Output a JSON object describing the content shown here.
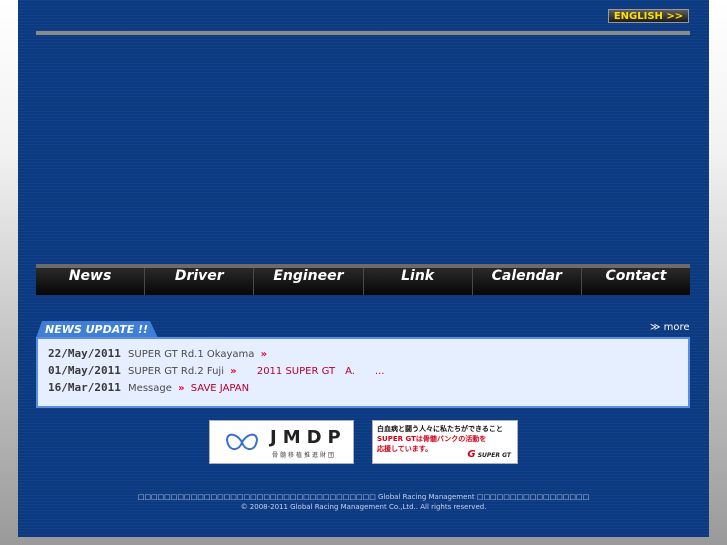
{
  "header": {
    "english_label": "ENGLISH >>"
  },
  "nav": {
    "items": [
      "News",
      "Driver",
      "Engineer",
      "Link",
      "Calendar",
      "Contact"
    ]
  },
  "news": {
    "tab_label": "NEWS UPDATE !!",
    "more_label": "≫ more",
    "items": [
      {
        "date": "22/May/2011",
        "title": "SUPER GT Rd.1 Okayama",
        "link": "",
        "extra": ""
      },
      {
        "date": "01/May/2011",
        "title": "SUPER GT Rd.2 Fuji",
        "link": "",
        "extra": "2011 SUPER GT　A.　　..."
      },
      {
        "date": "16/Mar/2011",
        "title": "Message",
        "link": "SAVE JAPAN",
        "extra": ""
      }
    ]
  },
  "banners": {
    "jmdp_name": "JMDP",
    "jmdp_sub": "骨髄移植推進財団",
    "gt_line1": "白血病と闘う人々に私たちができること",
    "gt_line2": "SUPER GTは骨髄バンクの活動を",
    "gt_line3": "応援しています。",
    "gt_logo": "SUPER GT"
  },
  "footer": {
    "line1": "□□□□□□□□□□□□□□□□□□□□□□□□□□□□□□□□□□□□ Global Racing Management □□□□□□□□□□□□□□□□□",
    "line2": "© 2008-2011 Global Racing Management Co.,Ltd.. All rights reserved."
  },
  "colors": {
    "page_bg": "#0c3a82",
    "accent_red": "#e8003a",
    "english_text": "#ffe000",
    "news_box": "#e6efff"
  }
}
